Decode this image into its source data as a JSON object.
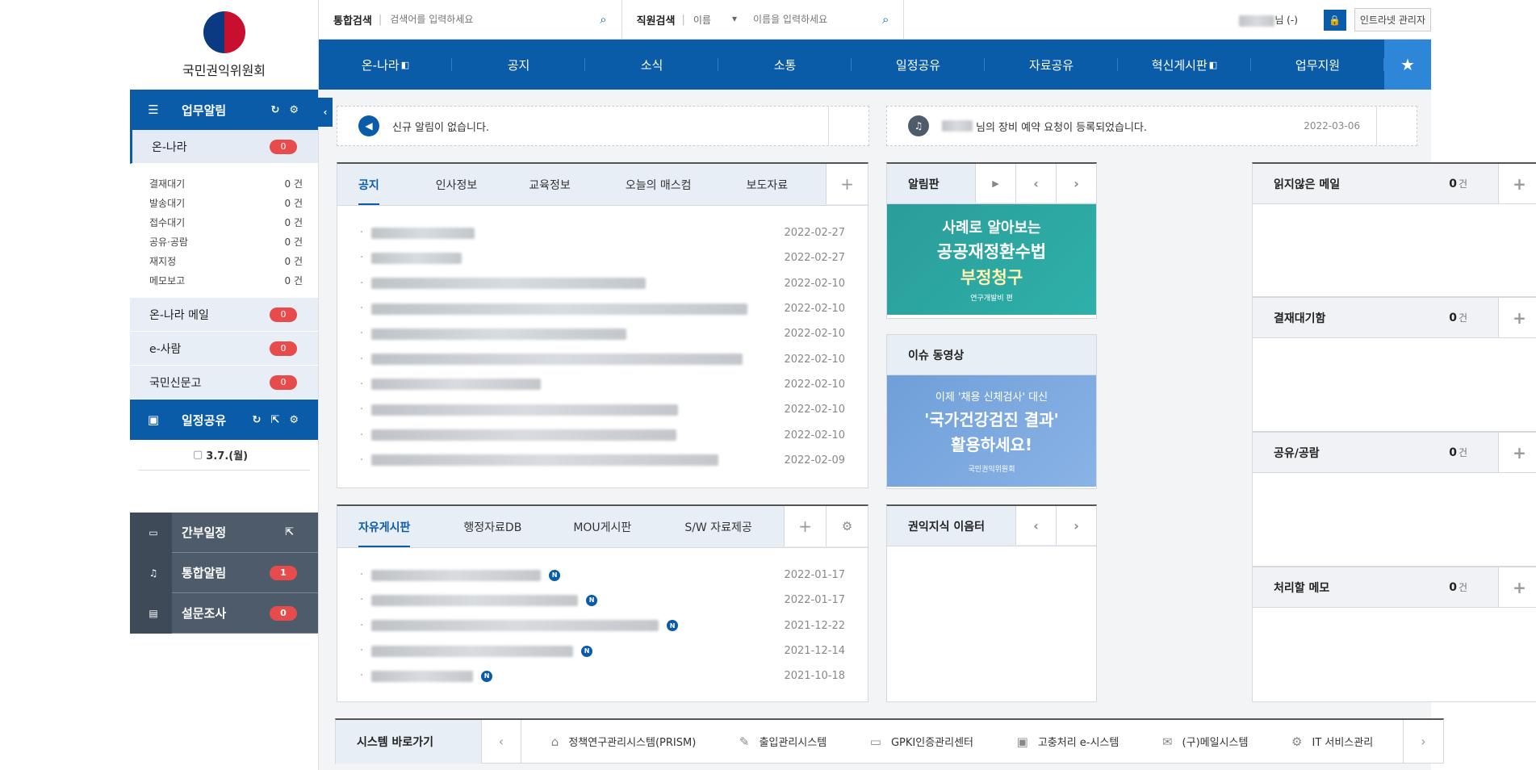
{
  "org": {
    "name": "국민권익위원회"
  },
  "topbar": {
    "integrated_search_label": "통합검색",
    "integrated_search_placeholder": "검색어를 입력하세요",
    "staff_search_label": "직원검색",
    "staff_search_select": "이름",
    "staff_search_placeholder": "이름을 입력하세요",
    "user_suffix": "님 (-)",
    "admin_label": "인트라넷 관리자"
  },
  "gnb": [
    "온-나라",
    "공지",
    "소식",
    "소통",
    "일정공유",
    "자료공유",
    "혁신게시판",
    "업무지원"
  ],
  "sidebar": {
    "work_alert": {
      "title": "업무알림"
    },
    "onnara": {
      "label": "온-나라",
      "count": "0"
    },
    "onnara_items": [
      {
        "label": "결재대기",
        "count": "0 건"
      },
      {
        "label": "발송대기",
        "count": "0 건"
      },
      {
        "label": "접수대기",
        "count": "0 건"
      },
      {
        "label": "공유·공람",
        "count": "0 건"
      },
      {
        "label": "재지정",
        "count": "0 건"
      },
      {
        "label": "메모보고",
        "count": "0 건"
      }
    ],
    "onnara_mail": {
      "label": "온-나라 메일",
      "count": "0"
    },
    "esaram": {
      "label": "e-사람",
      "count": "0"
    },
    "sinmungo": {
      "label": "국민신문고",
      "count": "0"
    },
    "schedule": {
      "title": "일정공유",
      "date": "3.7.(월)"
    },
    "exec_schedule": {
      "label": "간부일정"
    },
    "integrated_alert": {
      "label": "통합알림",
      "count": "1"
    },
    "survey": {
      "label": "설문조사",
      "count": "0"
    }
  },
  "notices": {
    "left": "신규 알림이 없습니다.",
    "right_text": "님의 장비 예약 요청이 등록되었습니다.",
    "right_date": "2022-03-06"
  },
  "board1": {
    "tabs": [
      "공지",
      "인사정보",
      "교육정보",
      "오늘의 매스컴",
      "보도자료"
    ],
    "rows": [
      {
        "date": "2022-02-27"
      },
      {
        "date": "2022-02-27"
      },
      {
        "date": "2022-02-10"
      },
      {
        "date": "2022-02-10"
      },
      {
        "date": "2022-02-10"
      },
      {
        "date": "2022-02-10"
      },
      {
        "date": "2022-02-10"
      },
      {
        "date": "2022-02-10"
      },
      {
        "date": "2022-02-10"
      },
      {
        "date": "2022-02-09"
      }
    ]
  },
  "board2": {
    "tabs": [
      "자유게시판",
      "행정자료DB",
      "MOU게시판",
      "S/W 자료제공"
    ],
    "new_badge": "N",
    "rows": [
      {
        "date": "2022-01-17"
      },
      {
        "date": "2022-01-17"
      },
      {
        "date": "2021-12-22"
      },
      {
        "date": "2021-12-14"
      },
      {
        "date": "2021-10-18"
      }
    ]
  },
  "alimpan": {
    "title": "알림판",
    "banner": {
      "line1": "사례로 알아보는",
      "line2": "공공재정환수법",
      "line3": "부정청구",
      "line4": "연구개발비 편"
    }
  },
  "issue_video": {
    "title": "이슈 동영상",
    "banner": {
      "line1": "이제 '채용 신체검사' 대신",
      "line2": "'국가건강검진 결과'",
      "line3": "활용하세요!",
      "line4": "국민권익위원회"
    }
  },
  "knowledge": {
    "title": "권익지식 이음터"
  },
  "right_boxes": [
    {
      "title": "읽지않은 메일",
      "count": "0",
      "unit": "건"
    },
    {
      "title": "결재대기함",
      "count": "0",
      "unit": "건"
    },
    {
      "title": "공유/공람",
      "count": "0",
      "unit": "건"
    },
    {
      "title": "처리할 메모",
      "count": "0",
      "unit": "건"
    }
  ],
  "systems": {
    "title": "시스템 바로가기",
    "items": [
      "정책연구관리시스템(PRISM)",
      "출입관리시스템",
      "GPKI인증관리센터",
      "고충처리 e-시스템",
      "(구)메일시스템",
      "IT 서비스관리"
    ]
  },
  "colors": {
    "primary": "#0b5ca8",
    "badge": "#e84b4b",
    "dark_sidebar": "#4e5b6b",
    "tab_bg": "#e8eef6"
  },
  "icons": [
    "search-icon",
    "refresh-icon",
    "gear-icon",
    "external-link-icon",
    "bell-icon",
    "speaker-icon",
    "lock-icon",
    "bookmark-star-icon",
    "chevron-left-icon",
    "chevron-right-icon",
    "play-icon",
    "plus-icon"
  ]
}
